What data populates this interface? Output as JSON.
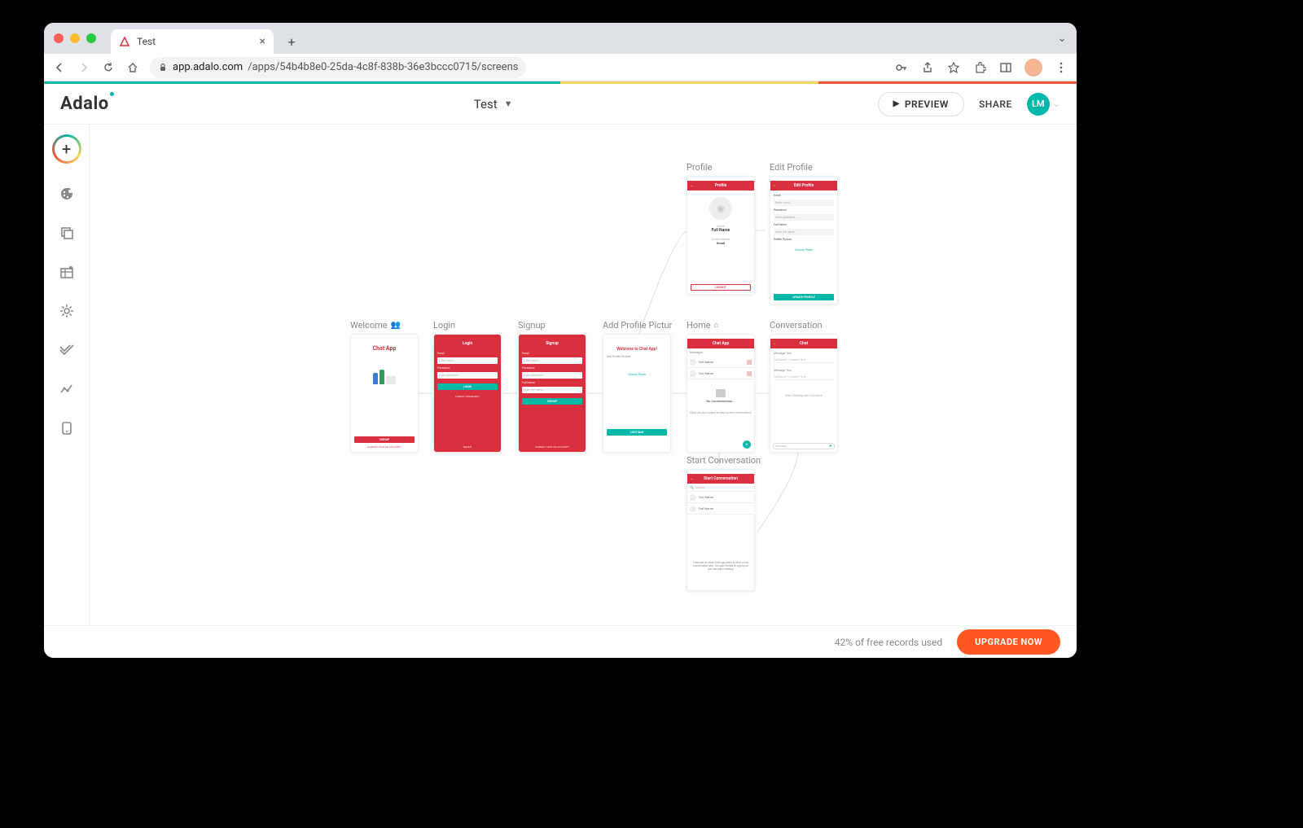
{
  "browser": {
    "tab_title": "Test",
    "url_host": "app.adalo.com",
    "url_path": "/apps/54b4b8e0-25da-4c8f-838b-36e3bccc0715/screens"
  },
  "header": {
    "brand": "Adalo",
    "project_name": "Test",
    "preview_label": "PREVIEW",
    "share_label": "SHARE",
    "user_initials": "LM"
  },
  "screens": {
    "welcome": {
      "label": "Welcome",
      "title": "Chat App",
      "signup_btn": "SIGNUP",
      "already": "ALREADY HAVE AN ACCOUNT?"
    },
    "login": {
      "label": "Login",
      "header": "Login",
      "email_lbl": "Email",
      "email_ph": "Enter email...",
      "pwd_lbl": "Password",
      "pwd_ph": "Enter password...",
      "btn": "LOGIN",
      "forgot": "FORGOT PASSWORD?",
      "signup": "SIGNUP"
    },
    "signup": {
      "label": "Signup",
      "header": "Signup",
      "email_lbl": "Email",
      "email_ph": "Enter email...",
      "pwd_lbl": "Password",
      "pwd_ph": "Enter password...",
      "name_lbl": "Full Name",
      "name_ph": "Enter full name...",
      "btn": "SIGNUP",
      "already": "ALREADY HAVE AN ACCOUNT?"
    },
    "addpic": {
      "label": "Add Profile Pictur",
      "welcome": "Welcome to Chat App!",
      "sub": "Add Profile Picture",
      "choose": "Choose Photo",
      "btn": "CONTINUE"
    },
    "profile": {
      "label": "Profile",
      "header": "Profile",
      "name_sub": "Name",
      "name": "Full Name",
      "email_sub": "Email Address",
      "email": "Email",
      "logout": "LOGOUT"
    },
    "editprofile": {
      "label": "Edit Profile",
      "header": "Edit Profile",
      "email_lbl": "Email",
      "email_ph": "Enter email...",
      "pwd_lbl": "Password",
      "pwd_ph": "Enter password...",
      "name_lbl": "Full Name",
      "name_ph": "Enter full name...",
      "photo_lbl": "Profile Picture",
      "choose": "Choose Photo",
      "btn": "UPDATE PROFILE"
    },
    "home": {
      "label": "Home",
      "header": "Chat App",
      "messages_lbl": "Messages",
      "row1": "Full Name",
      "row2": "Full Name",
      "empty_title": "No Conversations...",
      "empty_sub": "Click the plus button to start a new conversation!"
    },
    "conversation": {
      "label": "Conversation",
      "header": "Chat",
      "msg_lbl": "Message Text",
      "msg_ph": "Full Name • Created Time",
      "msg2_lbl": "Message Text",
      "msg2_ph": "Full Name • Created Time",
      "empty": "Start Chatting with Full Name",
      "footer_ph": "Message..."
    },
    "startconv": {
      "label": "Start Conversation",
      "header": "Start Conversation",
      "search_ph": "Search",
      "row1": "Full Name",
      "row2": "Full Name",
      "empty": "There are no other Chat App users to start a new conversation with. Tell your friends to sign up so you can start chatting!"
    }
  },
  "footer": {
    "records_text": "42% of free records used",
    "upgrade_label": "UPGRADE NOW"
  }
}
